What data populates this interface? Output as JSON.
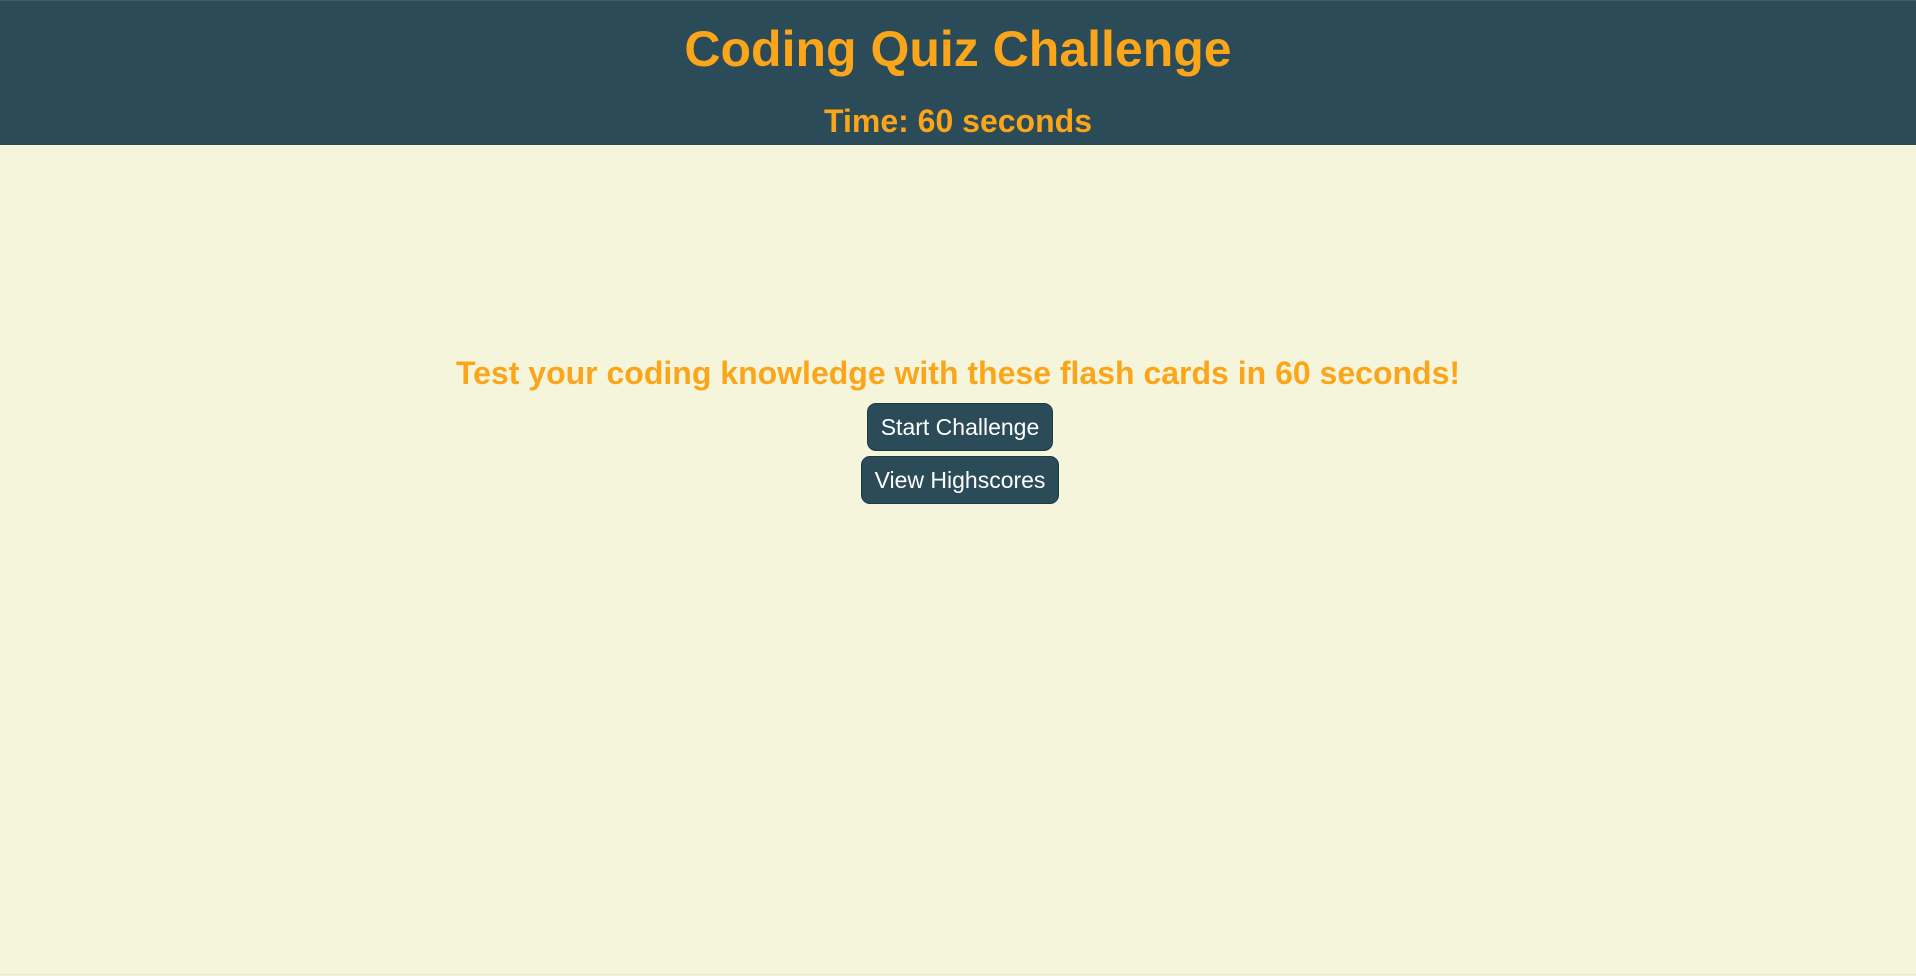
{
  "header": {
    "title": "Coding Quiz Challenge",
    "timer_text": "Time: 60 seconds"
  },
  "main": {
    "intro_text": "Test your coding knowledge with these flash cards in 60 seconds!",
    "start_button_label": "Start Challenge",
    "highscores_button_label": "View Highscores"
  },
  "colors": {
    "header_bg": "#2a4b57",
    "accent_orange": "#fba61a",
    "page_bg": "#f5f5dc",
    "button_text": "#ffffff"
  }
}
